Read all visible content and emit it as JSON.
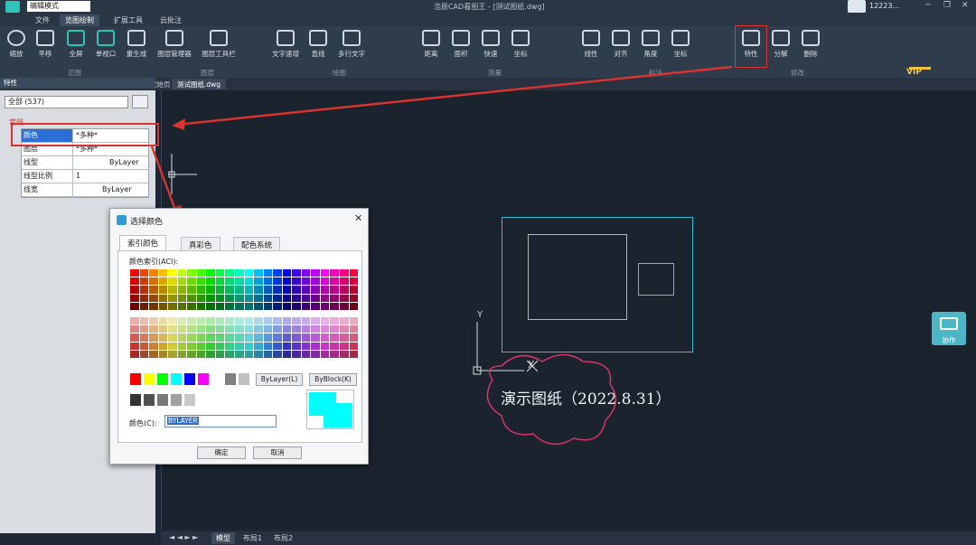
{
  "titlebar": {
    "mode": "编辑模式",
    "title": "浩辰CAD看图王 - [测试图纸.dwg]",
    "user": "12223..."
  },
  "menubar": {
    "items": [
      "文件",
      "览图绘制",
      "扩展工具",
      "云批注"
    ],
    "active": 1
  },
  "ribbon": {
    "buttons": [
      "缩放",
      "平移",
      "全屏",
      "单视口",
      "重生成",
      "图层管理器",
      "图层工具栏",
      "文字速增",
      "直线",
      "多行文字",
      "距离",
      "面积",
      "快速",
      "坐标",
      "线性",
      "对齐",
      "角度",
      "坐标",
      "特性",
      "分解",
      "删除"
    ],
    "groups": [
      "范围",
      "图层",
      "绘图",
      "测量",
      "标注",
      "修改"
    ],
    "vip": "VIP"
  },
  "doctabs": [
    "起始页",
    "测试图纸.dwg"
  ],
  "panel": {
    "title": "特性",
    "selection": "全部 (537)",
    "section": "常规",
    "rows": [
      {
        "name": "颜色",
        "value": "*多种*"
      },
      {
        "name": "图层",
        "value": "*多种*"
      },
      {
        "name": "线型",
        "value": "ByLayer"
      },
      {
        "name": "线型比例",
        "value": "1"
      },
      {
        "name": "线宽",
        "value": "ByLayer"
      }
    ]
  },
  "canvas": {
    "demo_text": "演示图纸（2022.8.31）",
    "collab": "协作",
    "axis_y": "Y",
    "axis_x": "X"
  },
  "layout_tabs": [
    "模型",
    "布局1",
    "布局2"
  ],
  "dialog": {
    "title": "选择颜色",
    "tabs": [
      "索引颜色",
      "真彩色",
      "配色系统"
    ],
    "aci_label": "颜色索引(ACI):",
    "bylayer": "ByLayer(L)",
    "byblock": "ByBlock(K)",
    "color_label": "颜色(C):",
    "color_value": "BYLAYER",
    "ok": "确定",
    "cancel": "取消"
  },
  "colors": {
    "highlight": "#d8332e",
    "accent": "#2ec4b6",
    "selection_blue": "#2b6fd6",
    "preview": "#00ffff"
  }
}
